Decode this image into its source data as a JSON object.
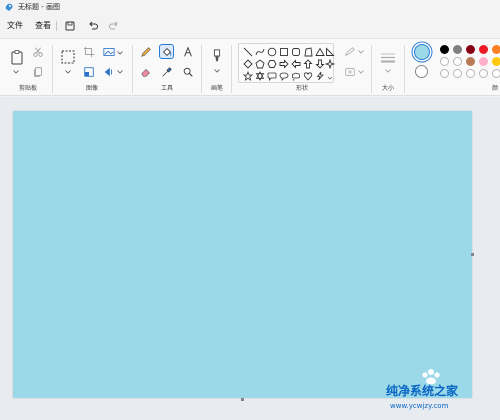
{
  "window": {
    "title": "无标题 - 画图"
  },
  "menu": {
    "file": "文件",
    "view": "查看"
  },
  "ribbon": {
    "groups": {
      "clipboard": "剪贴板",
      "image": "图像",
      "tools": "工具",
      "brushes": "画笔",
      "shapes": "形状",
      "size": "大小",
      "colors": "颜"
    }
  },
  "colors": {
    "primary": "#9bd9e9",
    "secondary": "#ffffff",
    "palette_row1": [
      "#000000",
      "#7f7f7f",
      "#880015",
      "#ed1c24",
      "#ff7f27"
    ],
    "palette_row2": [
      "empty",
      "empty",
      "#b97a57",
      "#ffaec9",
      "#ffc90e"
    ],
    "palette_row3": [
      "empty",
      "empty",
      "empty",
      "empty",
      "empty"
    ]
  },
  "canvas": {
    "fill": "#9bd9e9"
  },
  "watermark": {
    "title": "纯净系统之家",
    "url": "www.ycwjzy.com"
  }
}
